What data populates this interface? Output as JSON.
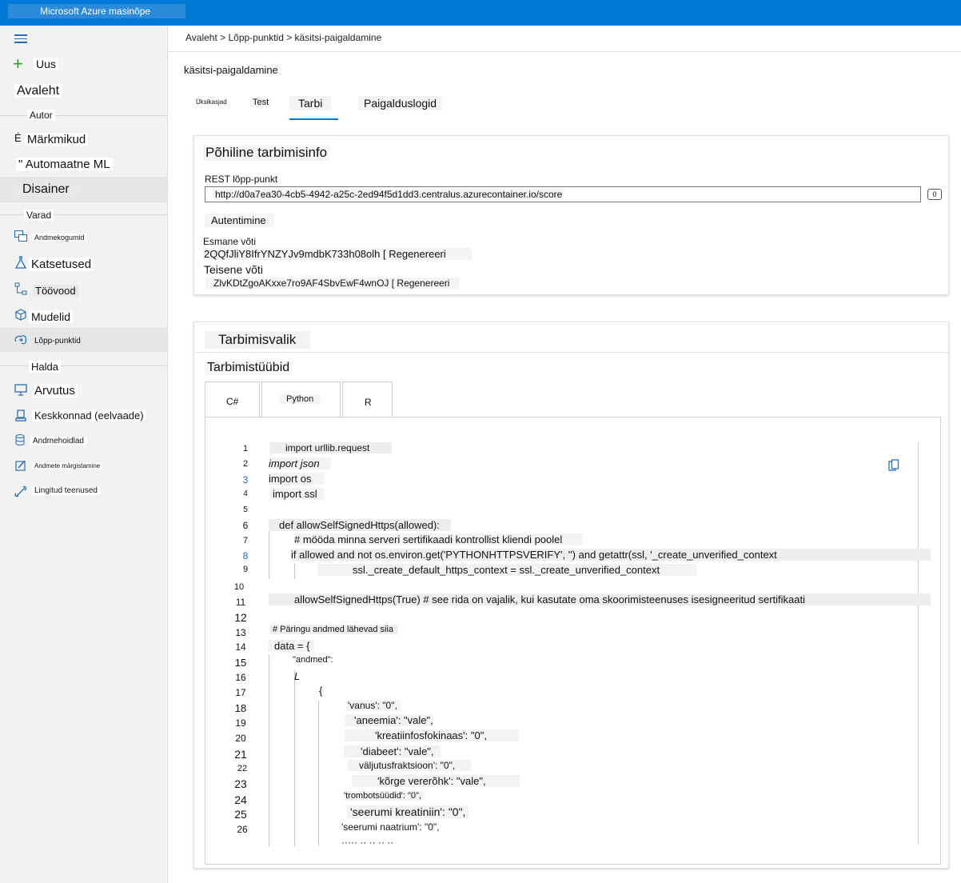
{
  "app": {
    "title": "Microsoft Azure masinõpe"
  },
  "sidebar": {
    "new": "Uus",
    "home": "Avaleht",
    "author_section": "Autor",
    "labeling": "Märkmikud",
    "labeling_prefix": "É",
    "automl": "\" Automaatne ML",
    "designer": "Disainer",
    "assets_section": "Varad",
    "datasets": "Andmekogumid",
    "experiments": "Katsetused",
    "pipelines": "Töövood",
    "models": "Mudelid",
    "endpoints": "Lõpp-punktid",
    "manage_section": "Halda",
    "compute": "Arvutus",
    "environments": "Keskkonnad (eelvaade)",
    "datastores": "Andmehoidlad",
    "data_labeling": "Andmete märgistamine",
    "linked_services": "Lingitud teenused"
  },
  "breadcrumb": "Avaleht > Lõpp-punktid > käsitsi-paigaldamine",
  "page_title": "käsitsi-paigaldamine",
  "tabs": {
    "details": "Üksikasjad",
    "test": "Test",
    "consume": "Tarbi",
    "logs": "Paigalduslogid"
  },
  "basic": {
    "heading": "Põhiline tarbimisinfo",
    "rest_label": "REST lõpp-punkt",
    "rest_url": "http://d0a7ea30-4cb5-4942-a25c-2ed94f5d1dd3.centralus.azurecontainer.io/score",
    "copy_glyph": "0",
    "auth": "Autentimine",
    "primary_label": "Esmane võti",
    "primary_value": "2QQfJliY8IfrYNZYJv9mdbK733h08olh [ Regenereeri",
    "secondary_label": "Teisene võti",
    "secondary_value": "ZlvKDtZgoAKxxe7ro9AF4SbvEwF4wnOJ [ Regenereeri"
  },
  "consume": {
    "heading": "Tarbimisvalik",
    "types_label": "Tarbimistüübid",
    "lang_tabs": [
      "C#",
      "Python",
      "R"
    ]
  },
  "code": {
    "line_numbers": [
      "1",
      "2",
      "3",
      "4",
      "5",
      "6",
      "7",
      "8",
      "9",
      "10",
      "11",
      "12",
      "13",
      "14",
      "15",
      "16",
      "17",
      "18",
      "19",
      "20",
      "21",
      "22",
      "23",
      "24",
      "25",
      "26"
    ],
    "lines": [
      "import urllib.request",
      "import json",
      "import os",
      "import ssl",
      "",
      "def allowSelfSignedHttps(allowed):",
      "# mööda minna serveri sertifikaadi kontrollist kliendi poolel",
      "if allowed and not os.environ.get('PYTHONHTTPSVERIFY', '') and getattr(ssl, '_create_unverified_context",
      "ssl._create_default_https_context = ssl._create_unverified_context",
      "",
      "allowSelfSignedHttps(True) # see rida on vajalik, kui kasutate oma skoorimisteenuses isesigneeritud sertifikaati",
      "",
      "# Päringu andmed lähevad siia",
      "data = {",
      "\"andmed\":",
      "L",
      "{",
      "'vanus': \"0\",",
      "'aneemia': \"vale\",",
      "'kreatiinfosfokinaas': \"0\",",
      "'diabeet': \"vale\",",
      "väljutusfraktsioon': \"0\",",
      "'kõrge vererõhk': \"vale\",",
      "'trombotsüüdid': \"0\",",
      "'seerumi kreatiniin': \"0\",",
      "'seerumi naatrium': \"0\","
    ]
  }
}
